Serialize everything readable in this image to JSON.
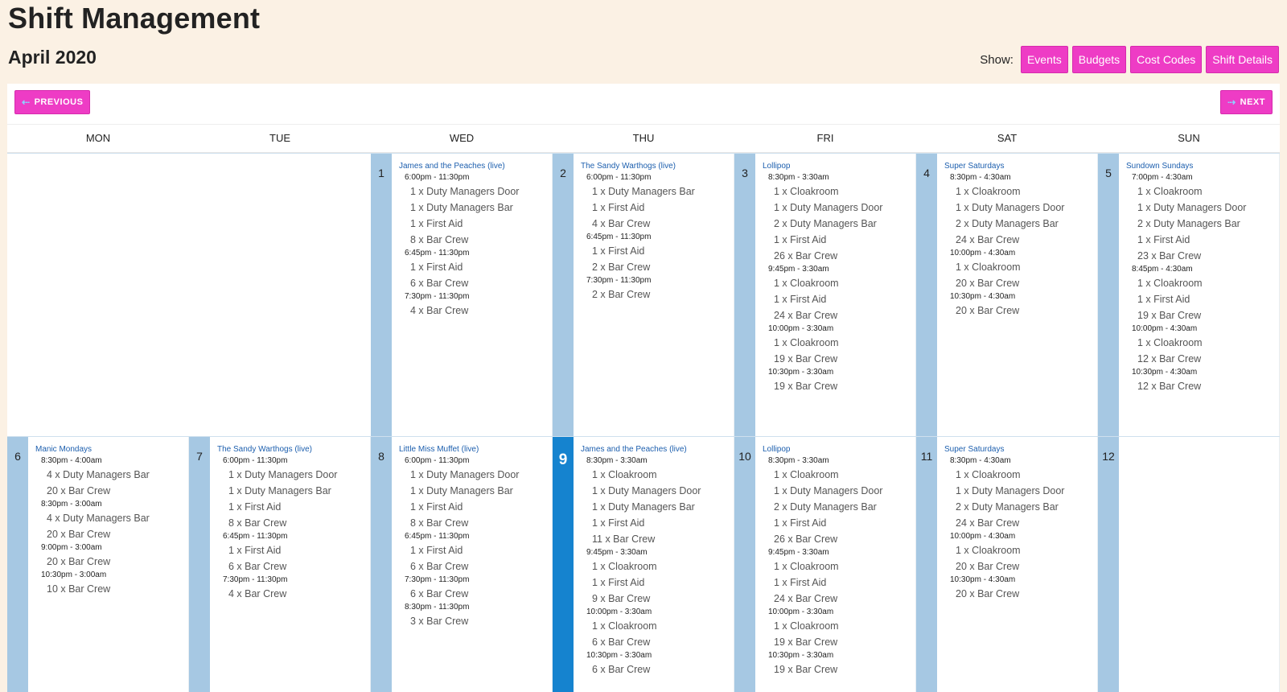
{
  "page_title": "Shift Management",
  "month_title": "April 2020",
  "show": {
    "label": "Show:",
    "buttons": [
      "Events",
      "Budgets",
      "Cost Codes",
      "Shift Details"
    ]
  },
  "nav": {
    "previous": "PREVIOUS",
    "next": "NEXT"
  },
  "weekdays": [
    "MON",
    "TUE",
    "WED",
    "THU",
    "FRI",
    "SAT",
    "SUN"
  ],
  "colors": {
    "accent": "#ee3cc5",
    "datebar": "#a6c8e3",
    "today": "#1583cf",
    "event_link": "#1d5fae",
    "background": "#fbf1e4"
  },
  "weeks": [
    [
      null,
      null,
      {
        "day": "1",
        "event": "James and the Peaches (live)",
        "lines": [
          {
            "t": "time",
            "v": "6:00pm - 11:30pm"
          },
          {
            "t": "role",
            "v": "1 x Duty Managers Door"
          },
          {
            "t": "role",
            "v": "1 x Duty Managers Bar"
          },
          {
            "t": "role",
            "v": "1 x First Aid"
          },
          {
            "t": "role",
            "v": "8 x Bar Crew"
          },
          {
            "t": "time",
            "v": "6:45pm - 11:30pm"
          },
          {
            "t": "role",
            "v": "1 x First Aid"
          },
          {
            "t": "role",
            "v": "6 x Bar Crew"
          },
          {
            "t": "time",
            "v": "7:30pm - 11:30pm"
          },
          {
            "t": "role",
            "v": "4 x Bar Crew"
          }
        ]
      },
      {
        "day": "2",
        "event": "The Sandy Warthogs (live)",
        "lines": [
          {
            "t": "time",
            "v": "6:00pm - 11:30pm"
          },
          {
            "t": "role",
            "v": "1 x Duty Managers Bar"
          },
          {
            "t": "role",
            "v": "1 x First Aid"
          },
          {
            "t": "role",
            "v": "4 x Bar Crew"
          },
          {
            "t": "time",
            "v": "6:45pm - 11:30pm"
          },
          {
            "t": "role",
            "v": "1 x First Aid"
          },
          {
            "t": "role",
            "v": "2 x Bar Crew"
          },
          {
            "t": "time",
            "v": "7:30pm - 11:30pm"
          },
          {
            "t": "role",
            "v": "2 x Bar Crew"
          }
        ]
      },
      {
        "day": "3",
        "event": "Lollipop",
        "lines": [
          {
            "t": "time",
            "v": "8:30pm - 3:30am"
          },
          {
            "t": "role",
            "v": "1 x Cloakroom"
          },
          {
            "t": "role",
            "v": "1 x Duty Managers Door"
          },
          {
            "t": "role",
            "v": "2 x Duty Managers Bar"
          },
          {
            "t": "role",
            "v": "1 x First Aid"
          },
          {
            "t": "role",
            "v": "26 x Bar Crew"
          },
          {
            "t": "time",
            "v": "9:45pm - 3:30am"
          },
          {
            "t": "role",
            "v": "1 x Cloakroom"
          },
          {
            "t": "role",
            "v": "1 x First Aid"
          },
          {
            "t": "role",
            "v": "24 x Bar Crew"
          },
          {
            "t": "time",
            "v": "10:00pm - 3:30am"
          },
          {
            "t": "role",
            "v": "1 x Cloakroom"
          },
          {
            "t": "role",
            "v": "19 x Bar Crew"
          },
          {
            "t": "time",
            "v": "10:30pm - 3:30am"
          },
          {
            "t": "role",
            "v": "19 x Bar Crew"
          }
        ]
      },
      {
        "day": "4",
        "event": "Super Saturdays",
        "lines": [
          {
            "t": "time",
            "v": "8:30pm - 4:30am"
          },
          {
            "t": "role",
            "v": "1 x Cloakroom"
          },
          {
            "t": "role",
            "v": "1 x Duty Managers Door"
          },
          {
            "t": "role",
            "v": "2 x Duty Managers Bar"
          },
          {
            "t": "role",
            "v": "24 x Bar Crew"
          },
          {
            "t": "time",
            "v": "10:00pm - 4:30am"
          },
          {
            "t": "role",
            "v": "1 x Cloakroom"
          },
          {
            "t": "role",
            "v": "20 x Bar Crew"
          },
          {
            "t": "time",
            "v": "10:30pm - 4:30am"
          },
          {
            "t": "role",
            "v": "20 x Bar Crew"
          }
        ]
      },
      {
        "day": "5",
        "event": "Sundown Sundays",
        "lines": [
          {
            "t": "time",
            "v": "7:00pm - 4:30am"
          },
          {
            "t": "role",
            "v": "1 x Cloakroom"
          },
          {
            "t": "role",
            "v": "1 x Duty Managers Door"
          },
          {
            "t": "role",
            "v": "2 x Duty Managers Bar"
          },
          {
            "t": "role",
            "v": "1 x First Aid"
          },
          {
            "t": "role",
            "v": "23 x Bar Crew"
          },
          {
            "t": "time",
            "v": "8:45pm - 4:30am"
          },
          {
            "t": "role",
            "v": "1 x Cloakroom"
          },
          {
            "t": "role",
            "v": "1 x First Aid"
          },
          {
            "t": "role",
            "v": "19 x Bar Crew"
          },
          {
            "t": "time",
            "v": "10:00pm - 4:30am"
          },
          {
            "t": "role",
            "v": "1 x Cloakroom"
          },
          {
            "t": "role",
            "v": "12 x Bar Crew"
          },
          {
            "t": "time",
            "v": "10:30pm - 4:30am"
          },
          {
            "t": "role",
            "v": "12 x Bar Crew"
          }
        ]
      }
    ],
    [
      {
        "day": "6",
        "event": "Manic Mondays",
        "lines": [
          {
            "t": "time",
            "v": "8:30pm - 4:00am"
          },
          {
            "t": "role",
            "v": "4 x Duty Managers Bar"
          },
          {
            "t": "role",
            "v": "20 x Bar Crew"
          },
          {
            "t": "time",
            "v": "8:30pm - 3:00am"
          },
          {
            "t": "role",
            "v": "4 x Duty Managers Bar"
          },
          {
            "t": "role",
            "v": "20 x Bar Crew"
          },
          {
            "t": "time",
            "v": "9:00pm - 3:00am"
          },
          {
            "t": "role",
            "v": "20 x Bar Crew"
          },
          {
            "t": "time",
            "v": "10:30pm - 3:00am"
          },
          {
            "t": "role",
            "v": "10 x Bar Crew"
          }
        ]
      },
      {
        "day": "7",
        "event": "The Sandy Warthogs (live)",
        "lines": [
          {
            "t": "time",
            "v": "6:00pm - 11:30pm"
          },
          {
            "t": "role",
            "v": "1 x Duty Managers Door"
          },
          {
            "t": "role",
            "v": "1 x Duty Managers Bar"
          },
          {
            "t": "role",
            "v": "1 x First Aid"
          },
          {
            "t": "role",
            "v": "8 x Bar Crew"
          },
          {
            "t": "time",
            "v": "6:45pm - 11:30pm"
          },
          {
            "t": "role",
            "v": "1 x First Aid"
          },
          {
            "t": "role",
            "v": "6 x Bar Crew"
          },
          {
            "t": "time",
            "v": "7:30pm - 11:30pm"
          },
          {
            "t": "role",
            "v": "4 x Bar Crew"
          }
        ]
      },
      {
        "day": "8",
        "event": "Little Miss Muffet (live)",
        "lines": [
          {
            "t": "time",
            "v": "6:00pm - 11:30pm"
          },
          {
            "t": "role",
            "v": "1 x Duty Managers Door"
          },
          {
            "t": "role",
            "v": "1 x Duty Managers Bar"
          },
          {
            "t": "role",
            "v": "1 x First Aid"
          },
          {
            "t": "role",
            "v": "8 x Bar Crew"
          },
          {
            "t": "time",
            "v": "6:45pm - 11:30pm"
          },
          {
            "t": "role",
            "v": "1 x First Aid"
          },
          {
            "t": "role",
            "v": "6 x Bar Crew"
          },
          {
            "t": "time",
            "v": "7:30pm - 11:30pm"
          },
          {
            "t": "role",
            "v": "6 x Bar Crew"
          },
          {
            "t": "time",
            "v": "8:30pm - 11:30pm"
          },
          {
            "t": "role",
            "v": "3 x Bar Crew"
          }
        ]
      },
      {
        "day": "9",
        "today": true,
        "event": "James and the Peaches (live)",
        "lines": [
          {
            "t": "time",
            "v": "8:30pm - 3:30am"
          },
          {
            "t": "role",
            "v": "1 x Cloakroom"
          },
          {
            "t": "role",
            "v": "1 x Duty Managers Door"
          },
          {
            "t": "role",
            "v": "1 x Duty Managers Bar"
          },
          {
            "t": "role",
            "v": "1 x First Aid"
          },
          {
            "t": "role",
            "v": "11 x Bar Crew"
          },
          {
            "t": "time",
            "v": "9:45pm - 3:30am"
          },
          {
            "t": "role",
            "v": "1 x Cloakroom"
          },
          {
            "t": "role",
            "v": "1 x First Aid"
          },
          {
            "t": "role",
            "v": "9 x Bar Crew"
          },
          {
            "t": "time",
            "v": "10:00pm - 3:30am"
          },
          {
            "t": "role",
            "v": "1 x Cloakroom"
          },
          {
            "t": "role",
            "v": "6 x Bar Crew"
          },
          {
            "t": "time",
            "v": "10:30pm - 3:30am"
          },
          {
            "t": "role",
            "v": "6 x Bar Crew"
          }
        ]
      },
      {
        "day": "10",
        "event": "Lollipop",
        "lines": [
          {
            "t": "time",
            "v": "8:30pm - 3:30am"
          },
          {
            "t": "role",
            "v": "1 x Cloakroom"
          },
          {
            "t": "role",
            "v": "1 x Duty Managers Door"
          },
          {
            "t": "role",
            "v": "2 x Duty Managers Bar"
          },
          {
            "t": "role",
            "v": "1 x First Aid"
          },
          {
            "t": "role",
            "v": "26 x Bar Crew"
          },
          {
            "t": "time",
            "v": "9:45pm - 3:30am"
          },
          {
            "t": "role",
            "v": "1 x Cloakroom"
          },
          {
            "t": "role",
            "v": "1 x First Aid"
          },
          {
            "t": "role",
            "v": "24 x Bar Crew"
          },
          {
            "t": "time",
            "v": "10:00pm - 3:30am"
          },
          {
            "t": "role",
            "v": "1 x Cloakroom"
          },
          {
            "t": "role",
            "v": "19 x Bar Crew"
          },
          {
            "t": "time",
            "v": "10:30pm - 3:30am"
          },
          {
            "t": "role",
            "v": "19 x Bar Crew"
          }
        ]
      },
      {
        "day": "11",
        "event": "Super Saturdays",
        "lines": [
          {
            "t": "time",
            "v": "8:30pm - 4:30am"
          },
          {
            "t": "role",
            "v": "1 x Cloakroom"
          },
          {
            "t": "role",
            "v": "1 x Duty Managers Door"
          },
          {
            "t": "role",
            "v": "2 x Duty Managers Bar"
          },
          {
            "t": "role",
            "v": "24 x Bar Crew"
          },
          {
            "t": "time",
            "v": "10:00pm - 4:30am"
          },
          {
            "t": "role",
            "v": "1 x Cloakroom"
          },
          {
            "t": "role",
            "v": "20 x Bar Crew"
          },
          {
            "t": "time",
            "v": "10:30pm - 4:30am"
          },
          {
            "t": "role",
            "v": "20 x Bar Crew"
          }
        ]
      },
      {
        "day": "12",
        "event": "",
        "lines": []
      }
    ]
  ]
}
